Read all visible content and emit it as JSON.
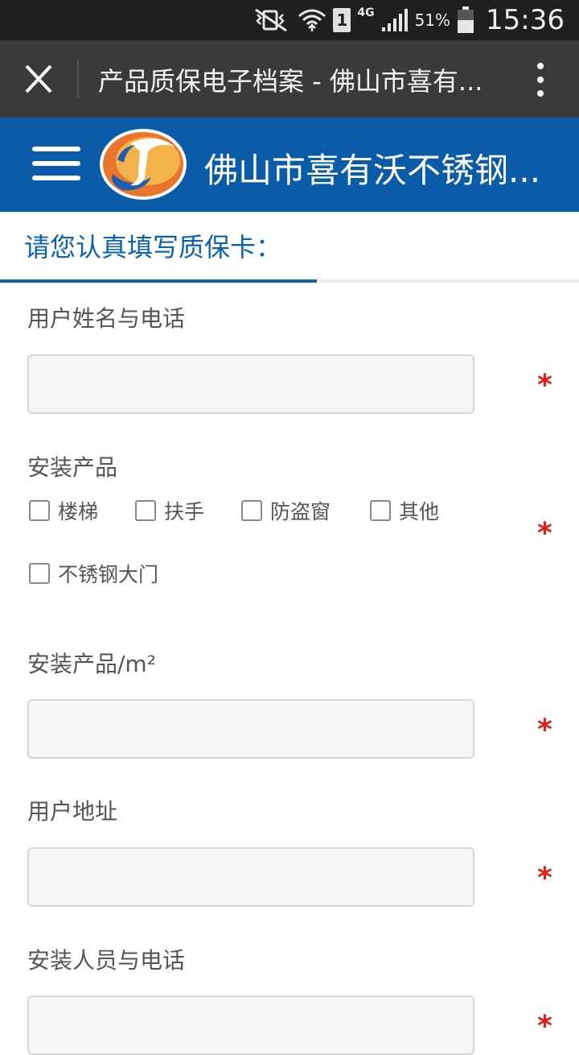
{
  "status_bar": {
    "sim_slot": "1",
    "network_type": "4G",
    "battery_percent": "51%",
    "time": "15:36",
    "icons": [
      "vibrate-mute-icon",
      "wifi-icon",
      "sim-icon",
      "signal-icon",
      "battery-icon"
    ]
  },
  "browser": {
    "page_title": "产品质保电子档案 - 佛山市喜有..."
  },
  "header": {
    "site_title": "佛山市喜有沃不锈钢...",
    "brand_color": "#0a5ca8"
  },
  "form": {
    "heading": "请您认真填写质保卡：",
    "accent_color": "#0a63b0",
    "required_mark": "*",
    "fields": {
      "name_phone": {
        "label": "用户姓名与电话",
        "value": ""
      },
      "product": {
        "label": "安装产品",
        "options": [
          "楼梯",
          "扶手",
          "防盗窗",
          "其他",
          "不锈钢大门"
        ]
      },
      "area": {
        "label": "安装产品/m²",
        "value": ""
      },
      "address": {
        "label": "用户地址",
        "value": ""
      },
      "installer": {
        "label": "安装人员与电话",
        "value": ""
      }
    }
  }
}
